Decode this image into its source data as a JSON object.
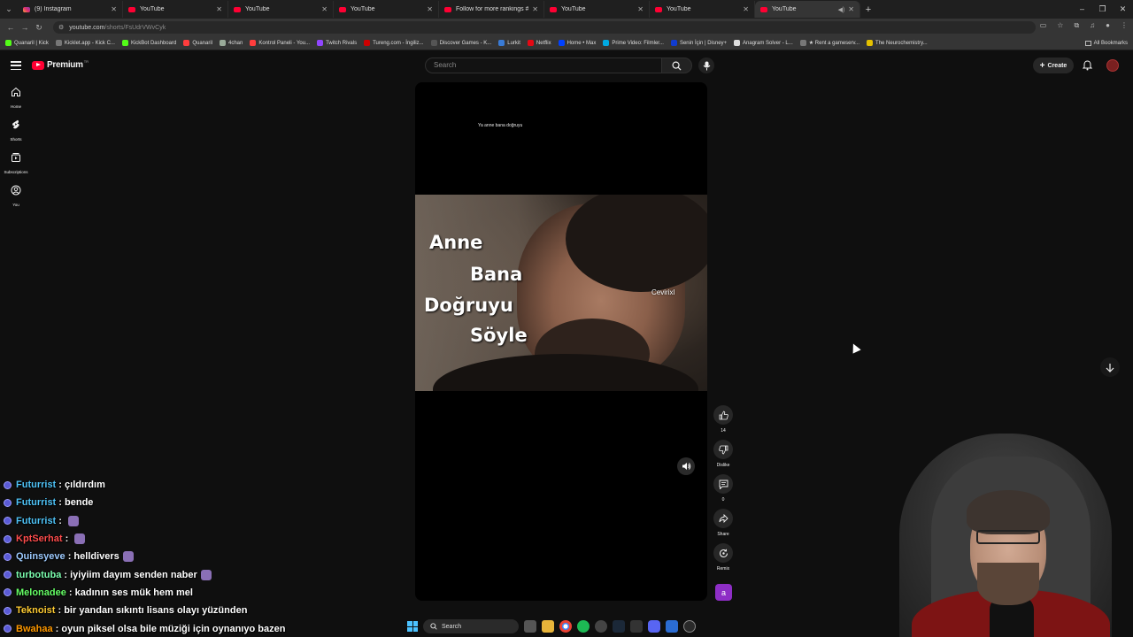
{
  "browser": {
    "tabs": [
      {
        "label": "(9) Instagram",
        "type": "ig"
      },
      {
        "label": "YouTube",
        "type": "yt"
      },
      {
        "label": "YouTube",
        "type": "yt"
      },
      {
        "label": "YouTube",
        "type": "yt"
      },
      {
        "label": "Follow for more rankings #fyp",
        "type": "yt"
      },
      {
        "label": "YouTube",
        "type": "yt"
      },
      {
        "label": "YouTube",
        "type": "yt"
      },
      {
        "label": "YouTube",
        "type": "yt",
        "active": true
      }
    ],
    "url_host": "youtube.com",
    "url_path": "/shorts/FsUdrVWvCyk",
    "bookmarks": [
      "Quanaril | Kick",
      "Kicklet.app - Kick C...",
      "KickBot Dashboard",
      "Quanaril",
      "4chan",
      "Kontrol Paneli - You...",
      "Twitch Rivals",
      "Tureng.com - İngiliz...",
      "Discover Games - K...",
      "Lurkit",
      "Netflix",
      "Home • Max",
      "Prime Video: Filmler...",
      "Senin İçin | Disney+",
      "Anagram Solver - L...",
      "★ Rent a gameserv...",
      "The Neurochemistry..."
    ],
    "all_bookmarks": "All Bookmarks"
  },
  "masthead": {
    "logo_text": "Premium",
    "country": "TR",
    "search_placeholder": "Search",
    "create_label": "Create"
  },
  "leftnav": [
    {
      "label": "Home",
      "icon": "home-icon"
    },
    {
      "label": "Shorts",
      "icon": "shorts-icon"
    },
    {
      "label": "Subscriptions",
      "icon": "subscriptions-icon"
    },
    {
      "label": "You",
      "icon": "you-icon"
    }
  ],
  "short": {
    "caption": "Ya anne bana doğruyu",
    "overlay_words": [
      "Anne",
      "Bana",
      "Doğruyu",
      "Söyle"
    ],
    "watermark": "Cevirixl"
  },
  "actions": {
    "like_count": "14",
    "dislike_label": "Dislike",
    "comment_count": "0",
    "share_label": "Share",
    "remix_label": "Remix",
    "channel_initial": "a"
  },
  "chat": [
    {
      "user": "Futurrist",
      "color": "#4fc3f7",
      "text": "çıldırdım",
      "emote": false
    },
    {
      "user": "Futurrist",
      "color": "#4fc3f7",
      "text": "bende",
      "emote": false
    },
    {
      "user": "Futurrist",
      "color": "#4fc3f7",
      "text": "",
      "emote": true
    },
    {
      "user": "KptSerhat",
      "color": "#ff4d4d",
      "text": "",
      "emote": true
    },
    {
      "user": "Quinsyeve",
      "color": "#9ecbff",
      "text": "helldivers",
      "emote": true
    },
    {
      "user": "turbotuba",
      "color": "#7cffb0",
      "text": "iyiyiim dayım senden naber",
      "emote": true
    },
    {
      "user": "Melonadee",
      "color": "#66ff66",
      "text": "kadının ses mük hem mel",
      "emote": false
    },
    {
      "user": "Teknoist",
      "color": "#ffcc33",
      "text": "bir yandan sıkıntı lisans olayı yüzünden",
      "emote": false
    },
    {
      "user": "Bwahaa",
      "color": "#ff9900",
      "text": "oyun piksel olsa bile müziği için oynanıyo bazen",
      "emote": false
    }
  ],
  "taskbar": {
    "search_label": "Search"
  }
}
